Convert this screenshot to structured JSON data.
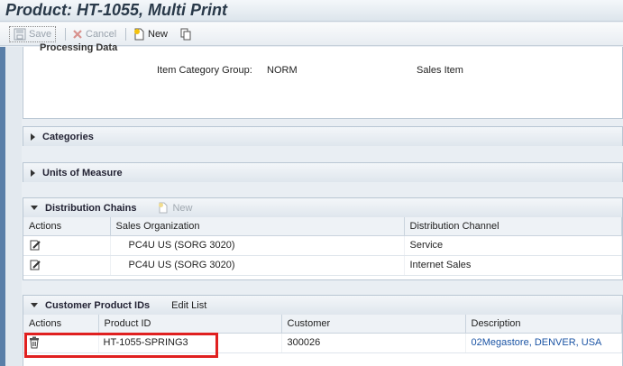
{
  "window": {
    "title": "Product: HT-1055, Multi Print"
  },
  "toolbar": {
    "save": "Save",
    "cancel": "Cancel",
    "new": "New"
  },
  "processing": {
    "heading": "Processing Data",
    "item_category_label": "Item Category Group:",
    "item_category_value": "NORM",
    "item_category_desc": "Sales Item"
  },
  "sections": {
    "categories": "Categories",
    "units": "Units of Measure",
    "distribution": "Distribution Chains",
    "distribution_new": "New",
    "customer_ids": "Customer Product IDs",
    "edit_list": "Edit List"
  },
  "distribution_table": {
    "columns": [
      "Actions",
      "Sales Organization",
      "Distribution Channel"
    ],
    "rows": [
      {
        "org": "PC4U US (SORG 3020)",
        "channel": "Service"
      },
      {
        "org": "PC4U US (SORG 3020)",
        "channel": "Internet Sales"
      }
    ]
  },
  "customer_table": {
    "columns": [
      "Actions",
      "Product ID",
      "Customer",
      "Description"
    ],
    "rows": [
      {
        "product_id": "HT-1055-SPRING3",
        "customer": "300026",
        "description": "02Megastore, DENVER, USA"
      }
    ]
  },
  "colors": {
    "highlight": "#e02020",
    "link": "#1c55a5",
    "accent": "#5a7fa8"
  }
}
